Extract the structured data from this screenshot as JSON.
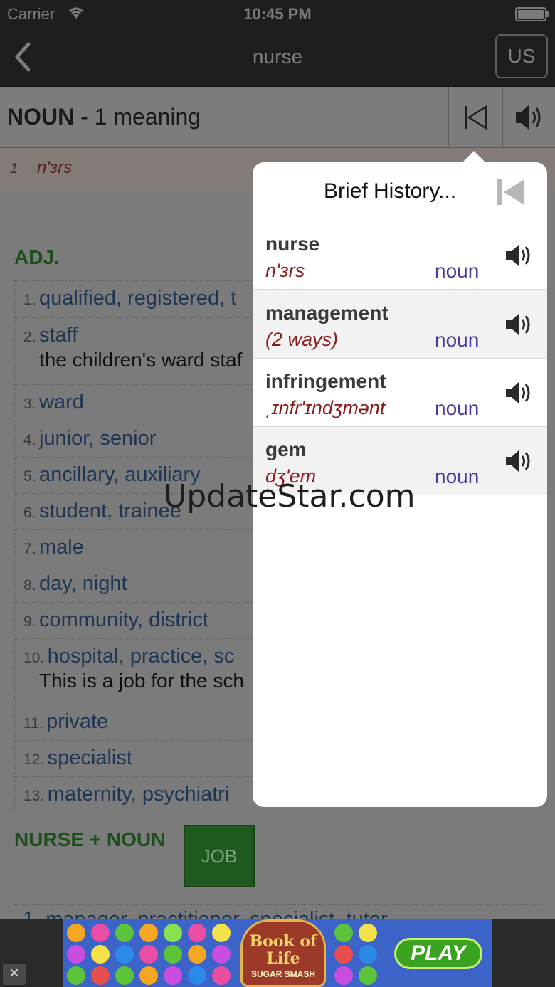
{
  "status": {
    "carrier": "Carrier",
    "time": "10:45 PM"
  },
  "nav": {
    "title": "nurse",
    "region_button": "US"
  },
  "header": {
    "pos": "NOUN",
    "meaning": " - 1 meaning"
  },
  "pronunciation": {
    "index": "1",
    "ipa": "n'ɜrs"
  },
  "section_adj": "ADJ.",
  "collocations": [
    {
      "n": "1.",
      "w": "qualified, registered, t",
      "ex": ""
    },
    {
      "n": "2.",
      "w": "staff",
      "ex": "the children's ward staf"
    },
    {
      "n": "3.",
      "w": "ward",
      "ex": ""
    },
    {
      "n": "4.",
      "w": "junior, senior",
      "ex": ""
    },
    {
      "n": "5.",
      "w": "ancillary, auxiliary",
      "ex": ""
    },
    {
      "n": "6.",
      "w": "student, trainee",
      "ex": ""
    },
    {
      "n": "7.",
      "w": "male",
      "ex": ""
    },
    {
      "n": "8.",
      "w": "day, night",
      "ex": ""
    },
    {
      "n": "9.",
      "w": "community, district",
      "ex": ""
    },
    {
      "n": "10.",
      "w": "hospital, practice, sc",
      "ex": "This is a job for the sch"
    },
    {
      "n": "11.",
      "w": "private",
      "ex": ""
    },
    {
      "n": "12.",
      "w": "specialist",
      "ex": ""
    },
    {
      "n": "13.",
      "w": "maternity, psychiatri",
      "ex": ""
    }
  ],
  "section_nurse_noun": "NURSE + NOUN",
  "job_button": "JOB",
  "cut_line": "1. manager, practitioner, specialist, tutor",
  "watermark": "UpdateStar.com",
  "popover": {
    "title": "Brief History...",
    "items": [
      {
        "word": "nurse",
        "pron": "n'ɜrs",
        "pos": "noun"
      },
      {
        "word": "management",
        "pron": "(2 ways)",
        "pos": "noun"
      },
      {
        "word": "infringement",
        "pron": "ˌɪnfr'ɪndʒmənt",
        "pos": "noun"
      },
      {
        "word": "gem",
        "pron": "dʒ'em",
        "pos": "noun"
      }
    ]
  },
  "ad": {
    "logo": "Book of Life",
    "logo_sub": "SUGAR SMASH",
    "play": "PLAY",
    "close": "×"
  },
  "colors": {
    "accent_green": "#1d4f1d",
    "link_blue": "#1e3654",
    "pos_purple": "#4b3aa3",
    "pron_red": "#8c1c1c"
  }
}
